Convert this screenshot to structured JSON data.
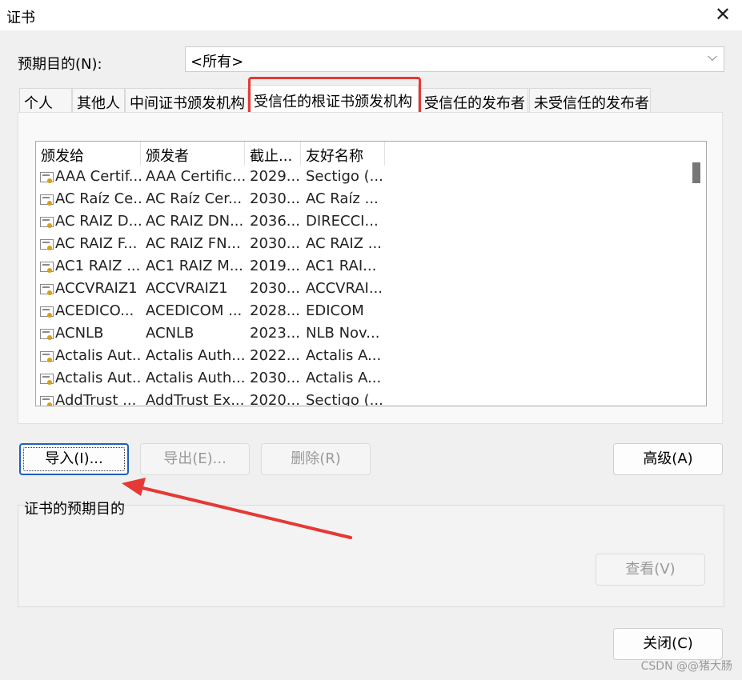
{
  "window": {
    "title": "证书",
    "close_symbol": "✕"
  },
  "purpose": {
    "label": "预期目的(N):",
    "value": "<所有>"
  },
  "tabs": [
    {
      "label": "个人"
    },
    {
      "label": "其他人"
    },
    {
      "label": "中间证书颁发机构"
    },
    {
      "label": "受信任的根证书颁发机构",
      "active": true
    },
    {
      "label": "受信任的发布者"
    },
    {
      "label": "未受信任的发布者"
    }
  ],
  "list": {
    "columns": [
      "颁发给",
      "颁发者",
      "截止...",
      "友好名称"
    ],
    "rows": [
      [
        "AAA Certif...",
        "AAA Certific...",
        "2029...",
        "Sectigo (..."
      ],
      [
        "AC Raíz Ce...",
        "AC Raíz Cer...",
        "2030...",
        "AC Raíz ..."
      ],
      [
        "AC RAIZ D...",
        "AC RAIZ DN...",
        "2036...",
        "DIRECCI..."
      ],
      [
        "AC RAIZ F...",
        "AC RAIZ FN...",
        "2030...",
        "AC RAIZ ..."
      ],
      [
        "AC1 RAIZ ...",
        "AC1 RAIZ M...",
        "2019...",
        "AC1 RAI..."
      ],
      [
        "ACCVRAIZ1",
        "ACCVRAIZ1",
        "2030...",
        "ACCVRAI..."
      ],
      [
        "ACEDICO...",
        "ACEDICOM ...",
        "2028...",
        "EDICOM"
      ],
      [
        "ACNLB",
        "ACNLB",
        "2023...",
        "NLB Nov..."
      ],
      [
        "Actalis Aut...",
        "Actalis Auth...",
        "2022...",
        "Actalis A..."
      ],
      [
        "Actalis Aut...",
        "Actalis Auth...",
        "2030...",
        "Actalis A..."
      ],
      [
        "AddTrust ...",
        "AddTrust Ex...",
        "2020...",
        "Sectigo (..."
      ]
    ]
  },
  "buttons": {
    "import": "导入(I)...",
    "export": "导出(E)...",
    "remove": "删除(R)",
    "advanced": "高级(A)",
    "view": "查看(V)",
    "close": "关闭(C)"
  },
  "purposes_group": {
    "label": "证书的预期目的"
  },
  "watermark": "CSDN @@猪大肠",
  "colors": {
    "highlight": "#e53935",
    "arrow": "#e53935",
    "focus": "#1f5fbf"
  }
}
